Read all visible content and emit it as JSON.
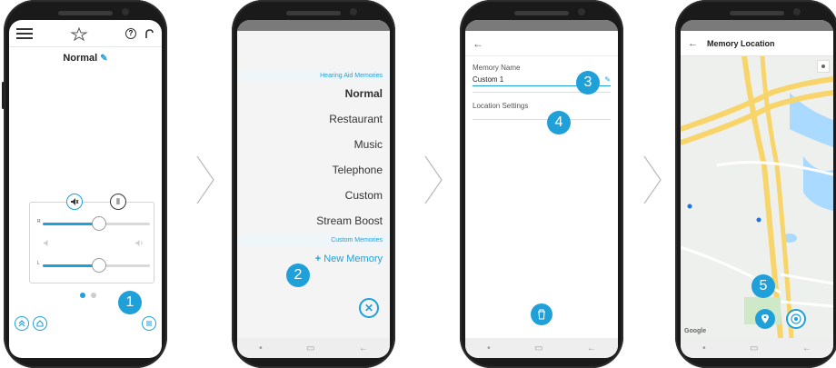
{
  "screen1": {
    "program_name": "Normal",
    "edit_glyph": "✎",
    "menu_icon": "hamburger-icon",
    "favorite_icon": "star-outline-icon",
    "help_glyph": "?",
    "slider_right_label": "R",
    "slider_left_label": "L",
    "right_level": 0.5,
    "left_level": 0.5,
    "mute_glyph": "🔇",
    "mic_glyph": "⦀"
  },
  "screen2": {
    "section_title": "Hearing Aid Memories",
    "memories": [
      "Normal",
      "Restaurant",
      "Music",
      "Telephone",
      "Custom",
      "Stream Boost"
    ],
    "active_memory": "Normal",
    "custom_section_title": "Custom Memories",
    "new_memory_plus": "+",
    "new_memory_label": "New Memory",
    "close_glyph": "✕"
  },
  "screen3": {
    "back_glyph": "←",
    "memory_name_label": "Memory Name",
    "memory_name_value": "Custom 1",
    "location_settings_label": "Location Settings",
    "delete_glyph": "🗑"
  },
  "screen4": {
    "back_glyph": "←",
    "title": "Memory Location",
    "map_attribution": "Google"
  },
  "badges": [
    "1",
    "2",
    "3",
    "4",
    "5"
  ],
  "colors": {
    "accent": "#1fa0d8",
    "phone_body": "#1a1a1a",
    "status_bar": "#7a7a7a"
  }
}
